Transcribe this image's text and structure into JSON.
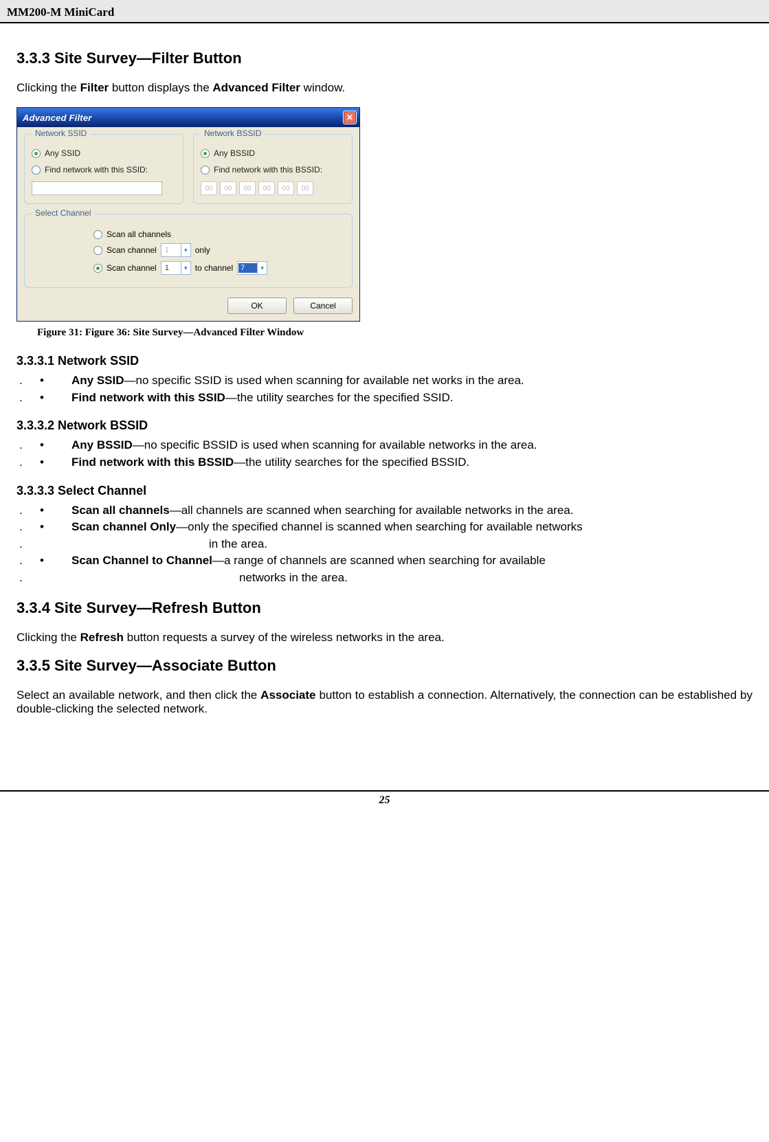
{
  "header": {
    "product": "MM200-M MiniCard"
  },
  "s333": {
    "title": "3.3.3 Site Survey—Filter Button",
    "intro_pre": "Clicking the ",
    "intro_b1": "Filter",
    "intro_mid": " button displays the ",
    "intro_b2": "Advanced Filter",
    "intro_post": " window."
  },
  "afwin": {
    "title": "Advanced Filter",
    "close_glyph": "✕",
    "ssid": {
      "legend": "Network SSID",
      "any": "Any SSID",
      "find": "Find network with this SSID:"
    },
    "bssid": {
      "legend": "Network BSSID",
      "any": "Any BSSID",
      "find": "Find network with this BSSID:",
      "octet": "00"
    },
    "chan": {
      "legend": "Select Channel",
      "all": "Scan all channels",
      "only_pre": "Scan channel",
      "only_post": "only",
      "range_pre": "Scan channel",
      "range_mid": "to channel",
      "dd1_disabled": "1",
      "dd_from": "1",
      "dd_to": "7"
    },
    "ok": "OK",
    "cancel": "Cancel"
  },
  "figcap": "Figure 31: Figure 36: Site Survey—Advanced Filter Window",
  "s3331": {
    "title": "3.3.3.1 Network SSID",
    "items": [
      {
        "term": "Any SSID",
        "rest": "—no specific SSID is used when scanning for available net works in the area."
      },
      {
        "term": "Find network with this SSID",
        "rest": "—the utility searches for the specified SSID."
      }
    ]
  },
  "s3332": {
    "title": "3.3.3.2 Network BSSID",
    "items": [
      {
        "term": "Any BSSID",
        "rest": "—no specific BSSID is used when scanning for available networks in the area."
      },
      {
        "term": "Find network with this BSSID",
        "rest": "—the utility searches for the specified BSSID."
      }
    ]
  },
  "s3333": {
    "title": "3.3.3.3 Select Channel",
    "r1_term": "Scan all channels",
    "r1_rest": "—all channels are scanned when searching for available networks in the area.",
    "r2_term": "Scan channel Only",
    "r2_rest": "—only the specified channel is scanned when searching for available networks",
    "r2_cont": "in the area.",
    "r3_term": "Scan Channel to Channel",
    "r3_rest": "—a range of channels are scanned when searching for available",
    "r3_cont": "networks in the area."
  },
  "s334": {
    "title": "3.3.4 Site Survey—Refresh Button",
    "p_pre": "Clicking the ",
    "p_b": "Refresh",
    "p_post": " button requests a survey of the wireless networks in the area."
  },
  "s335": {
    "title": "3.3.5 Site Survey—Associate Button",
    "p_pre": "Select an available network, and then click the ",
    "p_b": "Associate",
    "p_post": " button to establish a connection. Alternatively, the connection can be established by double-clicking the selected network."
  },
  "footer": {
    "pagenum": "25"
  },
  "glyph": {
    "bullet": "•",
    "dot": ".",
    "dd_arrow": "▾"
  }
}
